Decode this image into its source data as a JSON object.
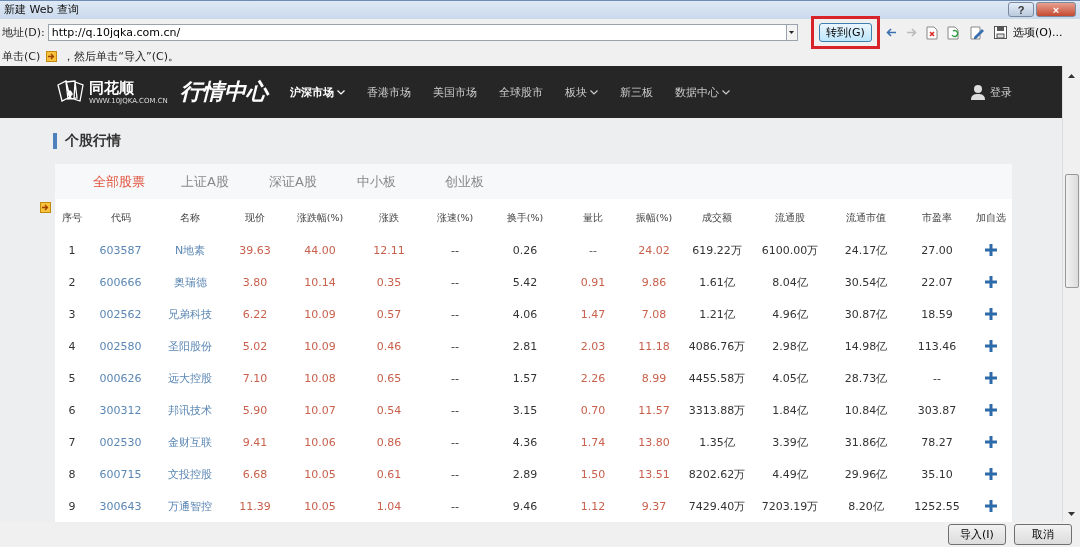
{
  "window": {
    "title": "新建 Web 查询",
    "controls": [
      {
        "kind": "help",
        "label": "?"
      },
      {
        "kind": "close",
        "label": "×"
      }
    ]
  },
  "address_bar": {
    "label": "地址(D):",
    "value": "http://q.10jqka.com.cn/",
    "go_button": "转到(G)",
    "go_highlighted": true,
    "tools": [
      {
        "kind": "back",
        "disabled": false
      },
      {
        "kind": "forward",
        "disabled": true
      },
      {
        "kind": "stop",
        "disabled": false
      },
      {
        "kind": "refresh",
        "disabled": false
      },
      {
        "kind": "edit",
        "disabled": false
      },
      {
        "kind": "save",
        "disabled": false
      }
    ],
    "options": "选项(O)..."
  },
  "hint": {
    "before": "单击(C)",
    "after": "，然后单击“导入”(C)。"
  },
  "site": {
    "logo": {
      "brand": "同花顺",
      "url": "WWW.10JQKA.COM.CN",
      "title": "行情中心"
    },
    "nav": [
      {
        "label": "沪深市场",
        "selected": true,
        "dropdown": true
      },
      {
        "label": "香港市场",
        "selected": false,
        "dropdown": false
      },
      {
        "label": "美国市场",
        "selected": false,
        "dropdown": false
      },
      {
        "label": "全球股市",
        "selected": false,
        "dropdown": false
      },
      {
        "label": "板块",
        "selected": false,
        "dropdown": true
      },
      {
        "label": "新三板",
        "selected": false,
        "dropdown": false
      },
      {
        "label": "数据中心",
        "selected": false,
        "dropdown": true
      }
    ],
    "login": "登录"
  },
  "section_title": "个股行情",
  "tabs": [
    {
      "label": "全部股票",
      "selected": true
    },
    {
      "label": "上证A股",
      "selected": false
    },
    {
      "label": "深证A股",
      "selected": false
    },
    {
      "label": "中小板",
      "selected": false
    },
    {
      "label": "创业板",
      "selected": false
    }
  ],
  "table": {
    "columns": [
      {
        "label": "序号",
        "kind": "plain"
      },
      {
        "label": "代码",
        "kind": "link"
      },
      {
        "label": "名称",
        "kind": "link"
      },
      {
        "label": "现价",
        "kind": "rise"
      },
      {
        "label": "涨跌幅(%)",
        "kind": "rise"
      },
      {
        "label": "涨跌",
        "kind": "rise"
      },
      {
        "label": "涨速(%)",
        "kind": "plain"
      },
      {
        "label": "换手(%)",
        "kind": "plain"
      },
      {
        "label": "量比",
        "kind": "rise"
      },
      {
        "label": "振幅(%)",
        "kind": "rise"
      },
      {
        "label": "成交额",
        "kind": "plain"
      },
      {
        "label": "流通股",
        "kind": "plain"
      },
      {
        "label": "流通市值",
        "kind": "plain"
      },
      {
        "label": "市盈率",
        "kind": "plain"
      },
      {
        "label": "加自选",
        "kind": "add"
      }
    ],
    "rows": [
      {
        "cells": [
          "1",
          "603587",
          "N地素",
          "39.63",
          "44.00",
          "12.11",
          "--",
          "0.26",
          "--",
          "24.02",
          "619.22万",
          "6100.00万",
          "24.17亿",
          "27.00"
        ]
      },
      {
        "cells": [
          "2",
          "600666",
          "奥瑞德",
          "3.80",
          "10.14",
          "0.35",
          "--",
          "5.42",
          "0.91",
          "9.86",
          "1.61亿",
          "8.04亿",
          "30.54亿",
          "22.07"
        ]
      },
      {
        "cells": [
          "3",
          "002562",
          "兄弟科技",
          "6.22",
          "10.09",
          "0.57",
          "--",
          "4.06",
          "1.47",
          "7.08",
          "1.21亿",
          "4.96亿",
          "30.87亿",
          "18.59"
        ]
      },
      {
        "cells": [
          "4",
          "002580",
          "圣阳股份",
          "5.02",
          "10.09",
          "0.46",
          "--",
          "2.81",
          "2.03",
          "11.18",
          "4086.76万",
          "2.98亿",
          "14.98亿",
          "113.46"
        ]
      },
      {
        "cells": [
          "5",
          "000626",
          "远大控股",
          "7.10",
          "10.08",
          "0.65",
          "--",
          "1.57",
          "2.26",
          "8.99",
          "4455.58万",
          "4.05亿",
          "28.73亿",
          "--"
        ]
      },
      {
        "cells": [
          "6",
          "300312",
          "邦讯技术",
          "5.90",
          "10.07",
          "0.54",
          "--",
          "3.15",
          "0.70",
          "11.57",
          "3313.88万",
          "1.84亿",
          "10.84亿",
          "303.87"
        ]
      },
      {
        "cells": [
          "7",
          "002530",
          "金财互联",
          "9.41",
          "10.06",
          "0.86",
          "--",
          "4.36",
          "1.74",
          "13.80",
          "1.35亿",
          "3.39亿",
          "31.86亿",
          "78.27"
        ]
      },
      {
        "cells": [
          "8",
          "600715",
          "文投控股",
          "6.68",
          "10.05",
          "0.61",
          "--",
          "2.89",
          "1.50",
          "13.51",
          "8202.62万",
          "4.49亿",
          "29.96亿",
          "35.10"
        ]
      },
      {
        "cells": [
          "9",
          "300643",
          "万通智控",
          "11.39",
          "10.05",
          "1.04",
          "--",
          "9.46",
          "1.12",
          "9.37",
          "7429.40万",
          "7203.19万",
          "8.20亿",
          "1252.55"
        ]
      }
    ]
  },
  "buttons": [
    {
      "label": "导入(I)"
    },
    {
      "label": "取消"
    }
  ]
}
